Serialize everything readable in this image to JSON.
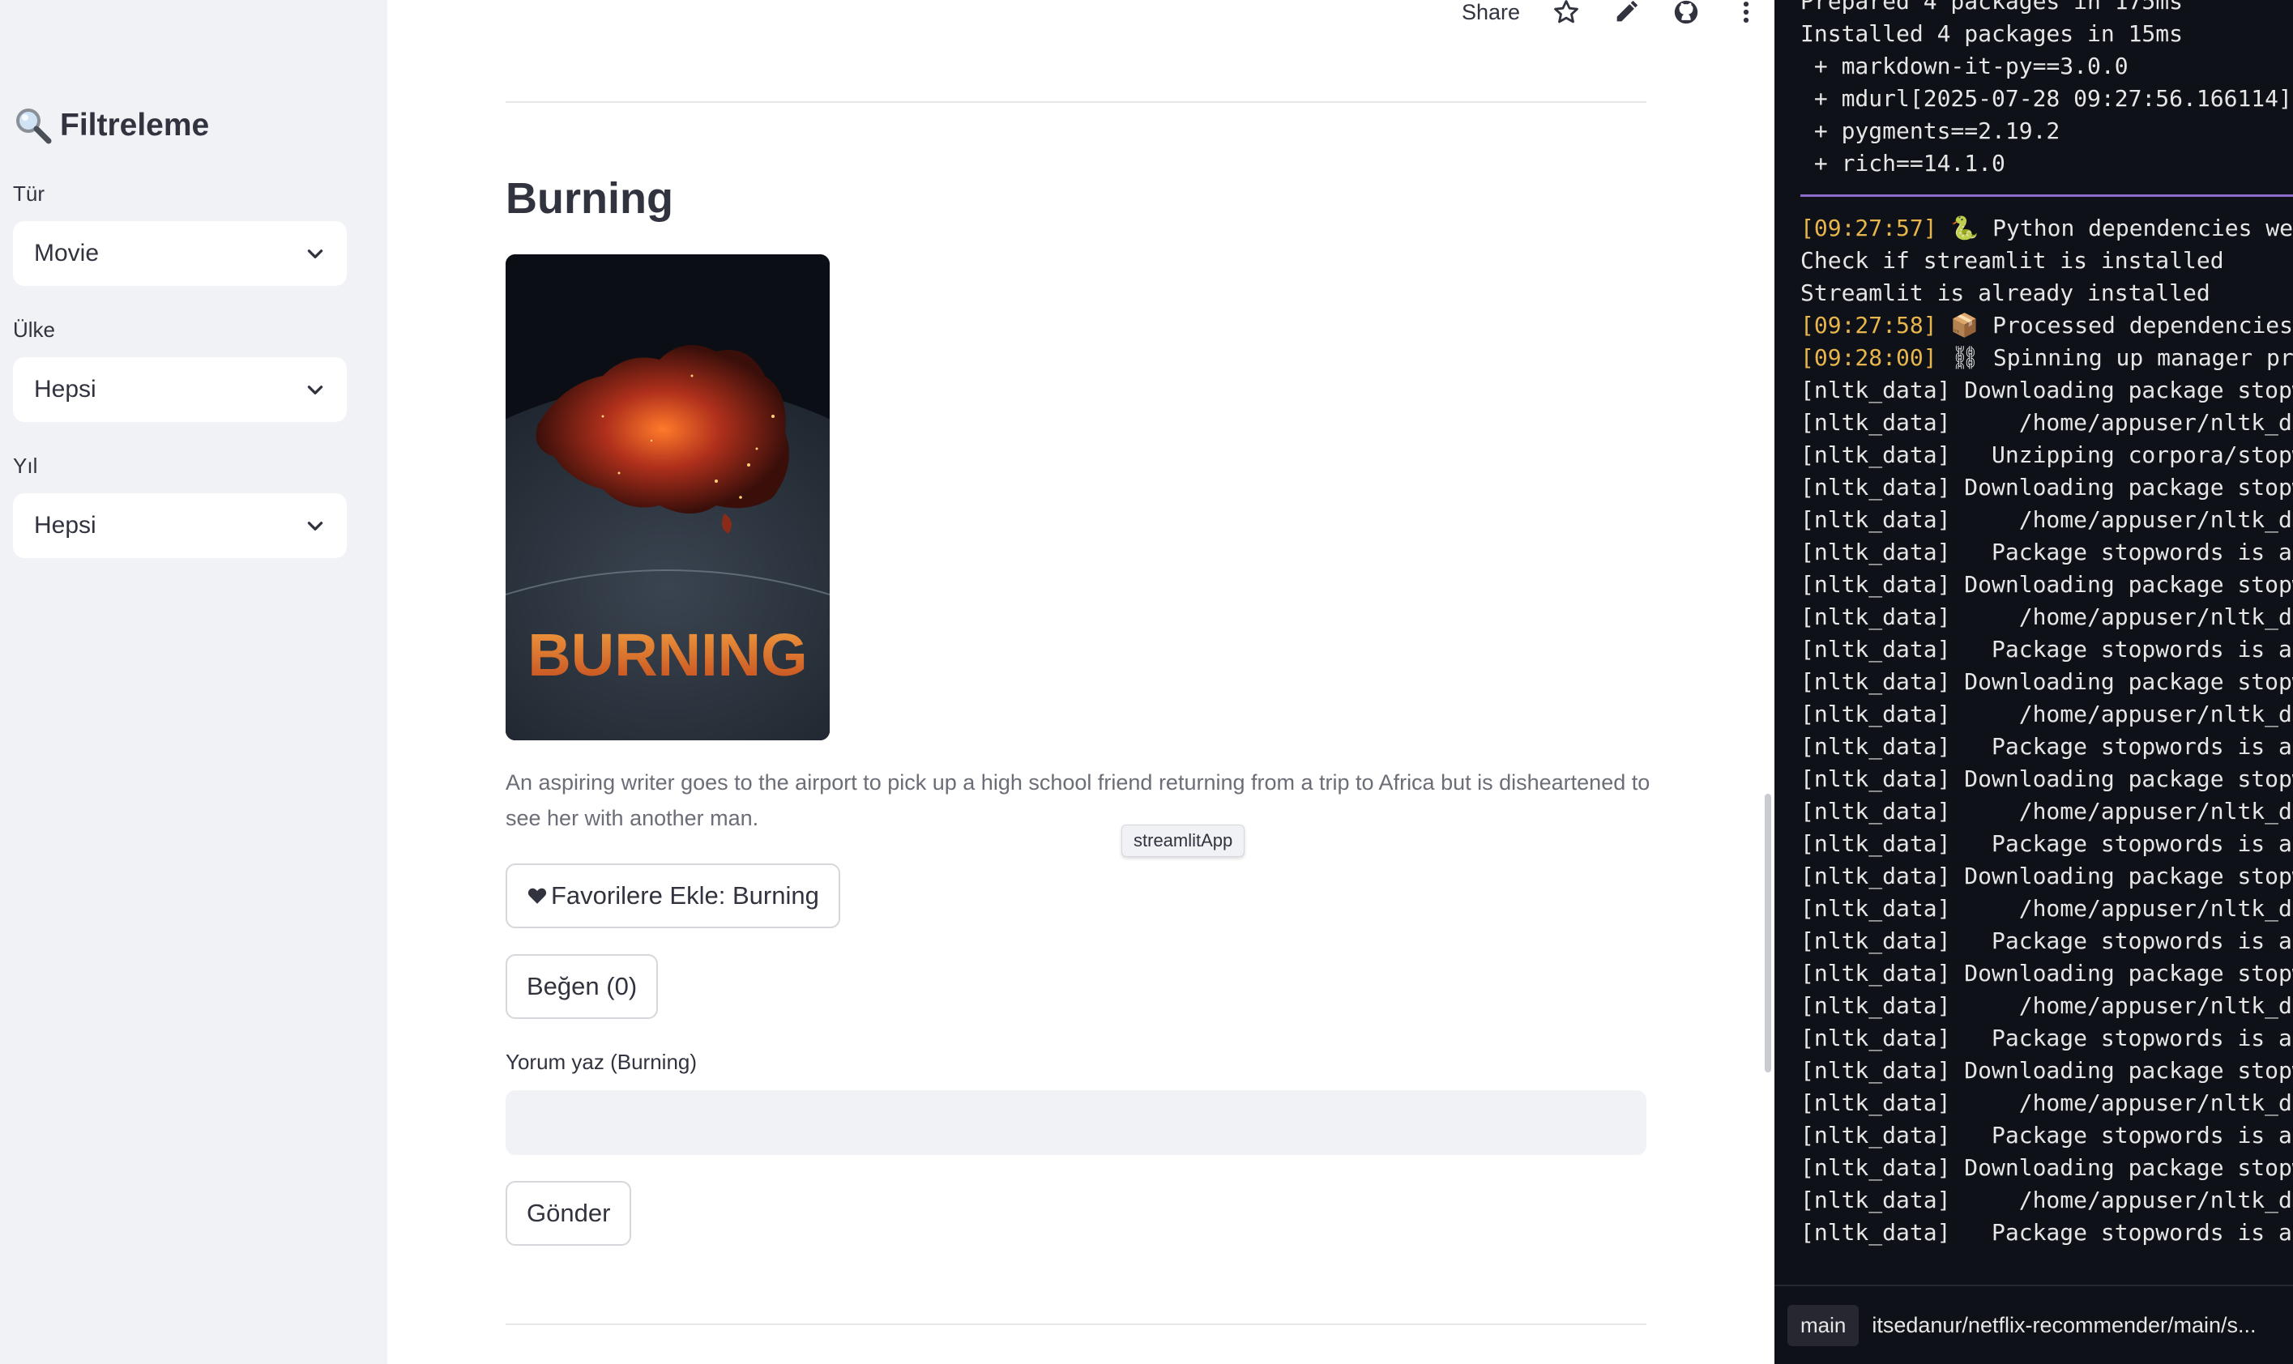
{
  "sidebar": {
    "title": "Filtreleme",
    "filters": [
      {
        "label": "Tür",
        "value": "Movie"
      },
      {
        "label": "Ülke",
        "value": "Hepsi"
      },
      {
        "label": "Yıl",
        "value": "Hepsi"
      }
    ]
  },
  "toolbar": {
    "share_label": "Share"
  },
  "movie": {
    "title": "Burning",
    "poster_text": "BURNING",
    "description": "An aspiring writer goes to the airport to pick up a high school friend returning from a trip to Africa but is disheartened to see her with another man.",
    "favorite_button": "Favorilere Ekle: Burning",
    "like_button": "Beğen (0)",
    "comment_label": "Yorum yaz (Burning)",
    "comment_value": "",
    "submit_button": "Gönder"
  },
  "tooltip": "streamlitApp",
  "terminal": {
    "lines": [
      {
        "ts": "",
        "text": "Prepared 4 packages in 175ms"
      },
      {
        "ts": "",
        "text": "Installed 4 packages in 15ms"
      },
      {
        "ts": "",
        "text": " + markdown-it-py==3.0.0"
      },
      {
        "ts": "",
        "text": " + mdurl[2025-07-28 09:27:56.166114]"
      },
      {
        "ts": "",
        "text": " + pygments==2.19.2"
      },
      {
        "ts": "",
        "text": " + rich==14.1.0"
      },
      {
        "ts": "",
        "text": ""
      },
      {
        "ts": "[09:27:57]",
        "text": " 🐍 Python dependencies we"
      },
      {
        "ts": "",
        "text": "Check if streamlit is installed"
      },
      {
        "ts": "",
        "text": "Streamlit is already installed"
      },
      {
        "ts": "[09:27:58]",
        "text": " 📦 Processed dependencies"
      },
      {
        "ts": "[09:28:00]",
        "text": " ⛓ Spinning up manager pro"
      },
      {
        "ts": "",
        "text": "[nltk_data] Downloading package stopw"
      },
      {
        "ts": "",
        "text": "[nltk_data]     /home/appuser/nltk_da"
      },
      {
        "ts": "",
        "text": "[nltk_data]   Unzipping corpora/stopw"
      },
      {
        "ts": "",
        "text": "[nltk_data] Downloading package stopw"
      },
      {
        "ts": "",
        "text": "[nltk_data]     /home/appuser/nltk_da"
      },
      {
        "ts": "",
        "text": "[nltk_data]   Package stopwords is al"
      },
      {
        "ts": "",
        "text": "[nltk_data] Downloading package stopw"
      },
      {
        "ts": "",
        "text": "[nltk_data]     /home/appuser/nltk_da"
      },
      {
        "ts": "",
        "text": "[nltk_data]   Package stopwords is al"
      },
      {
        "ts": "",
        "text": "[nltk_data] Downloading package stopw"
      },
      {
        "ts": "",
        "text": "[nltk_data]     /home/appuser/nltk_da"
      },
      {
        "ts": "",
        "text": "[nltk_data]   Package stopwords is al"
      },
      {
        "ts": "",
        "text": "[nltk_data] Downloading package stopw"
      },
      {
        "ts": "",
        "text": "[nltk_data]     /home/appuser/nltk_da"
      },
      {
        "ts": "",
        "text": "[nltk_data]   Package stopwords is al"
      },
      {
        "ts": "",
        "text": "[nltk_data] Downloading package stopw"
      },
      {
        "ts": "",
        "text": "[nltk_data]     /home/appuser/nltk_da"
      },
      {
        "ts": "",
        "text": "[nltk_data]   Package stopwords is al"
      },
      {
        "ts": "",
        "text": "[nltk_data] Downloading package stopw"
      },
      {
        "ts": "",
        "text": "[nltk_data]     /home/appuser/nltk_da"
      },
      {
        "ts": "",
        "text": "[nltk_data]   Package stopwords is al"
      },
      {
        "ts": "",
        "text": "[nltk_data] Downloading package stopw"
      },
      {
        "ts": "",
        "text": "[nltk_data]     /home/appuser/nltk_da"
      },
      {
        "ts": "",
        "text": "[nltk_data]   Package stopwords is al"
      },
      {
        "ts": "",
        "text": "[nltk_data] Downloading package stopw"
      },
      {
        "ts": "",
        "text": "[nltk_data]     /home/appuser/nltk_da"
      },
      {
        "ts": "",
        "text": "[nltk_data]   Package stopwords is al"
      }
    ],
    "branch": "main",
    "repo_path": "itsedanur/netflix-recommender/main/s..."
  },
  "colors": {
    "sidebar_bg": "#f0f2f6",
    "terminal_bg": "#0e1117",
    "timestamp": "#e8b64c",
    "separator": "#8b6cc9"
  }
}
